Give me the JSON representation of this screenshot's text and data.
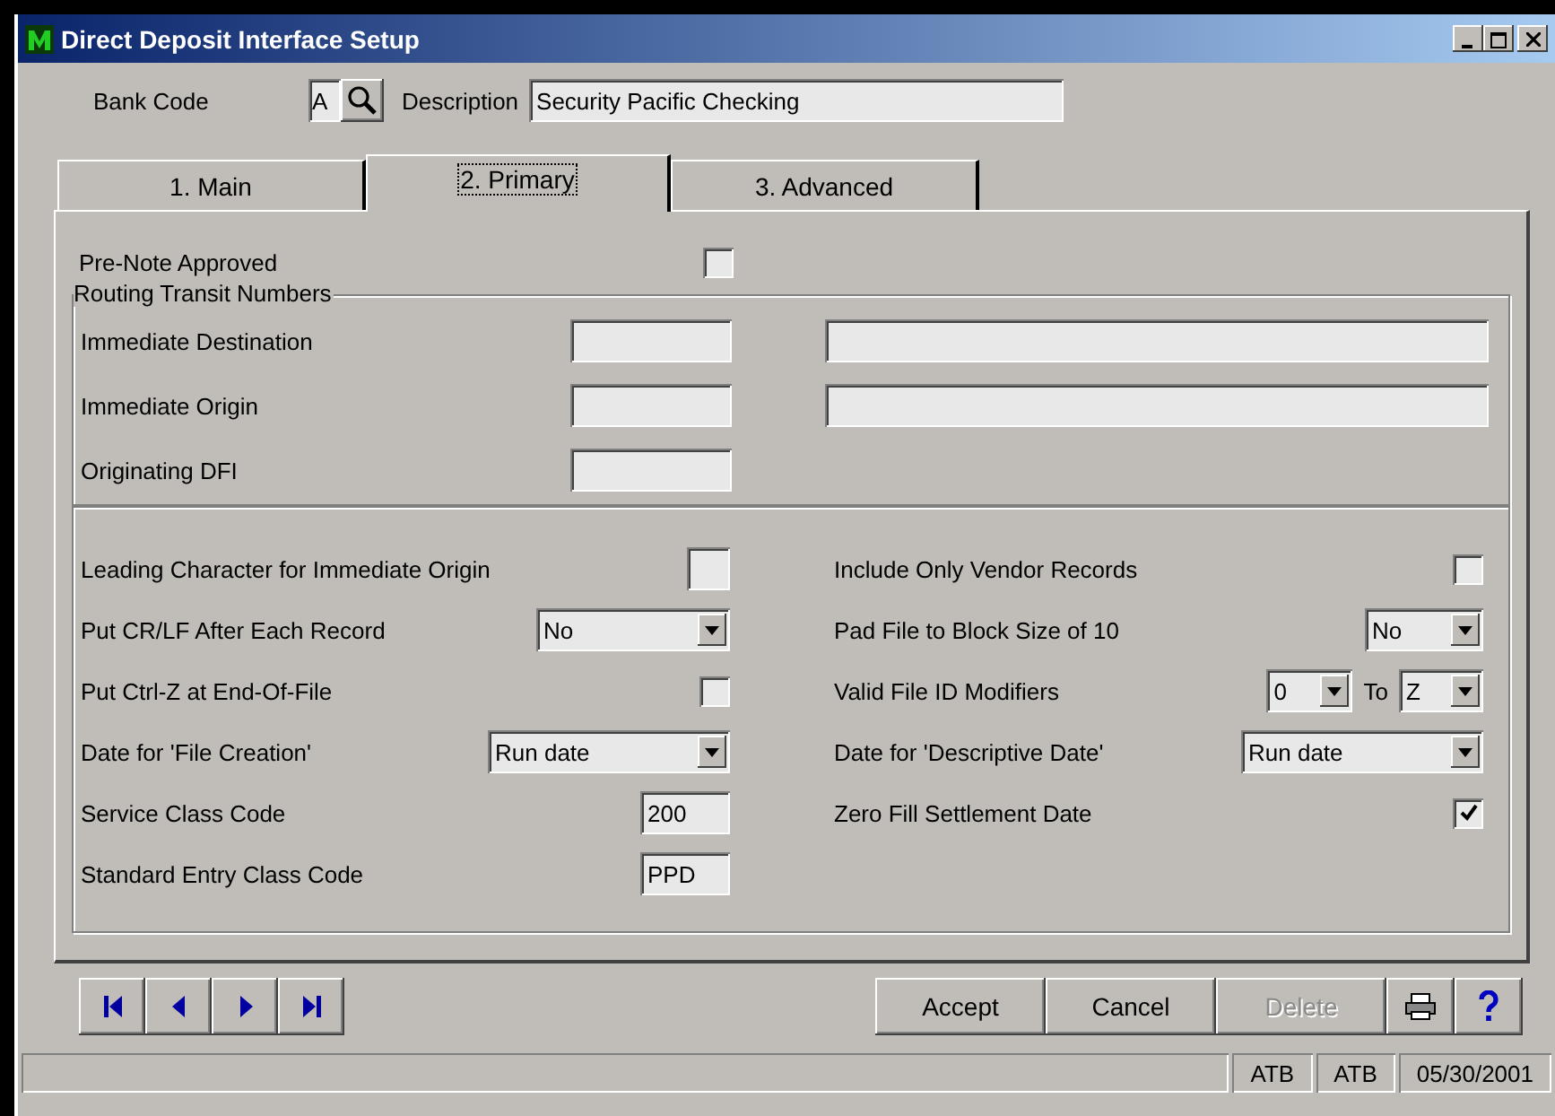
{
  "window": {
    "title": "Direct Deposit Interface Setup"
  },
  "header": {
    "bank_code_label": "Bank Code",
    "bank_code": "A",
    "description_label": "Description",
    "description": "Security Pacific Checking"
  },
  "tabs": [
    {
      "label": "1. Main",
      "selected": false
    },
    {
      "label": "2. Primary",
      "selected": true
    },
    {
      "label": "3. Advanced",
      "selected": false
    }
  ],
  "pre_note": {
    "label": "Pre-Note Approved",
    "checked": false
  },
  "routing": {
    "title": "Routing Transit Numbers",
    "rows": [
      {
        "label": "Immediate Destination",
        "wide_field": true
      },
      {
        "label": "Immediate Origin",
        "wide_field": true
      },
      {
        "label": "Originating DFI",
        "wide_field": false
      }
    ]
  },
  "options_left": [
    {
      "kind": "charfield",
      "label": "Leading Character for Immediate Origin"
    },
    {
      "kind": "select",
      "label": "Put CR/LF After Each Record",
      "value": "No"
    },
    {
      "kind": "checkbox",
      "label": "Put Ctrl-Z at End-Of-File",
      "checked": false
    },
    {
      "kind": "select",
      "label": "Date for 'File Creation'",
      "value": "Run date"
    },
    {
      "kind": "text",
      "label": "Service Class Code",
      "value": "200"
    },
    {
      "kind": "text",
      "label": "Standard Entry Class Code",
      "value": "PPD"
    }
  ],
  "options_right": [
    {
      "kind": "checkbox",
      "label": "Include Only Vendor Records",
      "checked": false
    },
    {
      "kind": "select",
      "label": "Pad File to Block Size of 10",
      "value": "No"
    },
    {
      "kind": "range",
      "label": "Valid File ID Modifiers",
      "from": "0",
      "to_label": "To",
      "to": "Z"
    },
    {
      "kind": "select",
      "label": "Date for 'Descriptive Date'",
      "value": "Run date"
    },
    {
      "kind": "checkbox",
      "label": "Zero Fill Settlement Date",
      "checked": true
    }
  ],
  "buttons": [
    {
      "label": "Accept",
      "disabled": false
    },
    {
      "label": "Cancel",
      "disabled": false
    },
    {
      "label": "Delete",
      "disabled": true
    }
  ],
  "status_bar": [
    "ATB",
    "ATB",
    "05/30/2001"
  ]
}
